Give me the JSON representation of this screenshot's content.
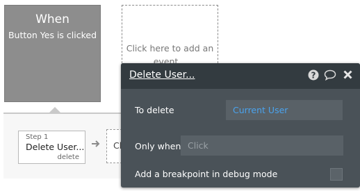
{
  "trigger": {
    "title": "When",
    "subtitle": "Button Yes is clicked"
  },
  "add_event": {
    "label": "Click here to add an event..."
  },
  "step": {
    "number_label": "Step 1",
    "title": "Delete User...",
    "action": "delete"
  },
  "next_step_placeholder": {
    "label": "Cl"
  },
  "panel": {
    "title": "Delete User...",
    "icons": [
      "help-icon",
      "comment-icon",
      "close-icon"
    ],
    "to_delete": {
      "label": "To delete",
      "value": "Current User"
    },
    "only_when": {
      "label": "Only when",
      "placeholder": "Click"
    },
    "breakpoint": {
      "label": "Add a breakpoint in debug mode",
      "checked": false
    }
  },
  "colors": {
    "trigger_bg": "#8d8d8d",
    "panel_bg": "#4a5258",
    "panel_header_bg": "#333b40",
    "link_value": "#4aa3ee"
  }
}
